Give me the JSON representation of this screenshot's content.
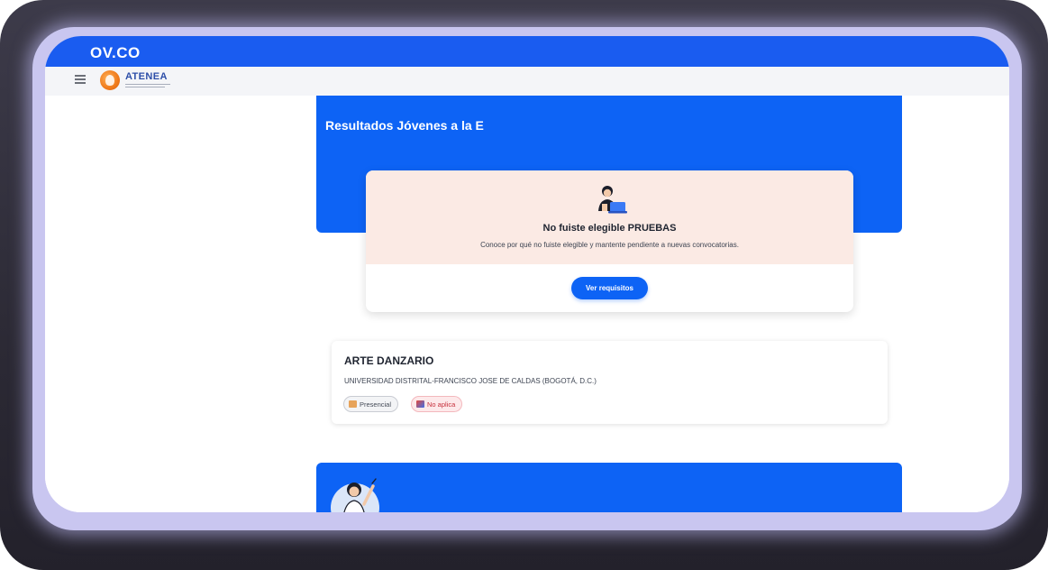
{
  "browser": {
    "url_fragment": "OV.CO"
  },
  "header": {
    "logo_text": "ATENEA"
  },
  "hero": {
    "title": "Resultados Jóvenes a la E"
  },
  "result": {
    "title": "No fuiste elegible PRUEBAS",
    "description": "Conoce por qué no fuiste elegible y mantente pendiente a nuevas convocatorias.",
    "button_label": "Ver requisitos"
  },
  "program": {
    "name": "ARTE DANZARIO",
    "institution": "UNIVERSIDAD DISTRITAL-FRANCISCO JOSE DE CALDAS (BOGOTÁ, D.C.)",
    "chips": [
      {
        "label": "Presencial",
        "icon": "building-icon"
      },
      {
        "label": "No aplica",
        "icon": "book-icon"
      }
    ]
  },
  "colors": {
    "primary_blue": "#0d63f5",
    "result_bg": "#fbeae4",
    "chip_red": "#c62f3b"
  }
}
